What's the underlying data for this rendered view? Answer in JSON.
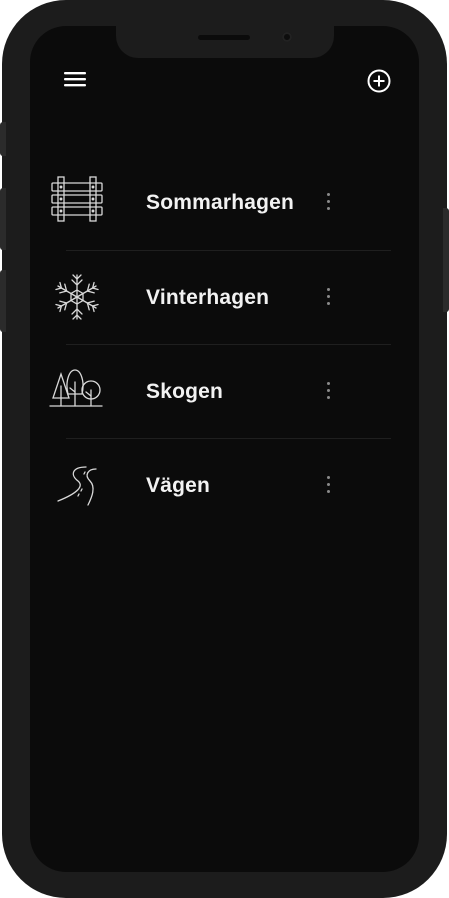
{
  "header": {
    "menu_icon": "hamburger-menu-icon",
    "add_icon": "plus-circle-icon"
  },
  "areas": [
    {
      "name": "Sommarhagen",
      "icon": "fence-icon"
    },
    {
      "name": "Vinterhagen",
      "icon": "snowflake-icon"
    },
    {
      "name": "Skogen",
      "icon": "trees-icon"
    },
    {
      "name": "Vägen",
      "icon": "road-icon"
    }
  ],
  "colors": {
    "background": "#0b0b0b",
    "text": "#f2f2f2",
    "divider": "#1f1f1f",
    "kebab": "#8a8a8a",
    "frame": "#1c1c1c"
  }
}
